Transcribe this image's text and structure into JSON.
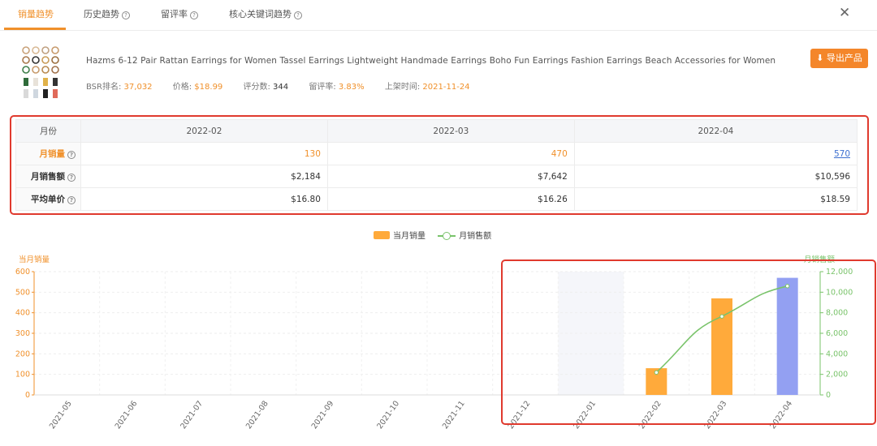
{
  "tabs": [
    {
      "label": "销量趋势",
      "active": true,
      "help": false
    },
    {
      "label": "历史趋势",
      "active": false,
      "help": true
    },
    {
      "label": "留评率",
      "active": false,
      "help": true
    },
    {
      "label": "核心关键词趋势",
      "active": false,
      "help": true
    }
  ],
  "close_icon": "✕",
  "product": {
    "title": "Hazms 6-12 Pair Rattan Earrings for Women Tassel Earrings Lightweight Handmade Earrings Boho Fun Earrings Fashion Earrings Beach Accessories for Women",
    "stats": [
      {
        "label": "BSR排名:",
        "value": "37,032"
      },
      {
        "label": "价格:",
        "value": "$18.99"
      },
      {
        "label": "评分数:",
        "value": "344"
      },
      {
        "label": "留评率:",
        "value": "3.83%"
      },
      {
        "label": "上架时间:",
        "value": "2021-11-24"
      }
    ],
    "export_label": "导出产品"
  },
  "table": {
    "header_label": "月份",
    "months": [
      "2022-02",
      "2022-03",
      "2022-04"
    ],
    "rows": [
      {
        "label": "月销量",
        "values": [
          "130",
          "470",
          "570"
        ]
      },
      {
        "label": "月销售额",
        "values": [
          "$2,184",
          "$7,642",
          "$10,596"
        ]
      },
      {
        "label": "平均单价",
        "values": [
          "$16.80",
          "$16.26",
          "$18.59"
        ]
      }
    ]
  },
  "colors": {
    "accent": "#f0902a",
    "bar": "#ffaa3b",
    "bar_highlight": "#93a0f2",
    "line": "#79c36a",
    "highlight_band": "#f5f6fa",
    "red_box": "#e03a2e"
  },
  "chart_data": {
    "type": "bar",
    "legend": [
      "当月销量",
      "月销售额"
    ],
    "left_axis_title": "当月销量",
    "right_axis_title": "月销售额",
    "categories": [
      "2021-05",
      "2021-06",
      "2021-07",
      "2021-08",
      "2021-09",
      "2021-10",
      "2021-11",
      "2021-12",
      "2022-01",
      "2022-02",
      "2022-03",
      "2022-04"
    ],
    "series": [
      {
        "name": "当月销量",
        "type": "bar",
        "axis": "left",
        "values": [
          null,
          null,
          null,
          null,
          null,
          null,
          null,
          null,
          null,
          130,
          470,
          570
        ]
      },
      {
        "name": "月销售额",
        "type": "line",
        "axis": "right",
        "values": [
          null,
          null,
          null,
          null,
          null,
          null,
          null,
          null,
          null,
          2184,
          7642,
          10596
        ]
      }
    ],
    "left_ylim": [
      0,
      600
    ],
    "left_ticks": [
      0,
      100,
      200,
      300,
      400,
      500,
      600
    ],
    "right_ylim": [
      0,
      12000
    ],
    "right_ticks": [
      "0",
      "2,000",
      "4,000",
      "6,000",
      "8,000",
      "10,000",
      "12,000"
    ],
    "highlighted_category": "2022-01",
    "selected_bar_category": "2022-04",
    "grid": true,
    "legend_position": "top-center"
  }
}
